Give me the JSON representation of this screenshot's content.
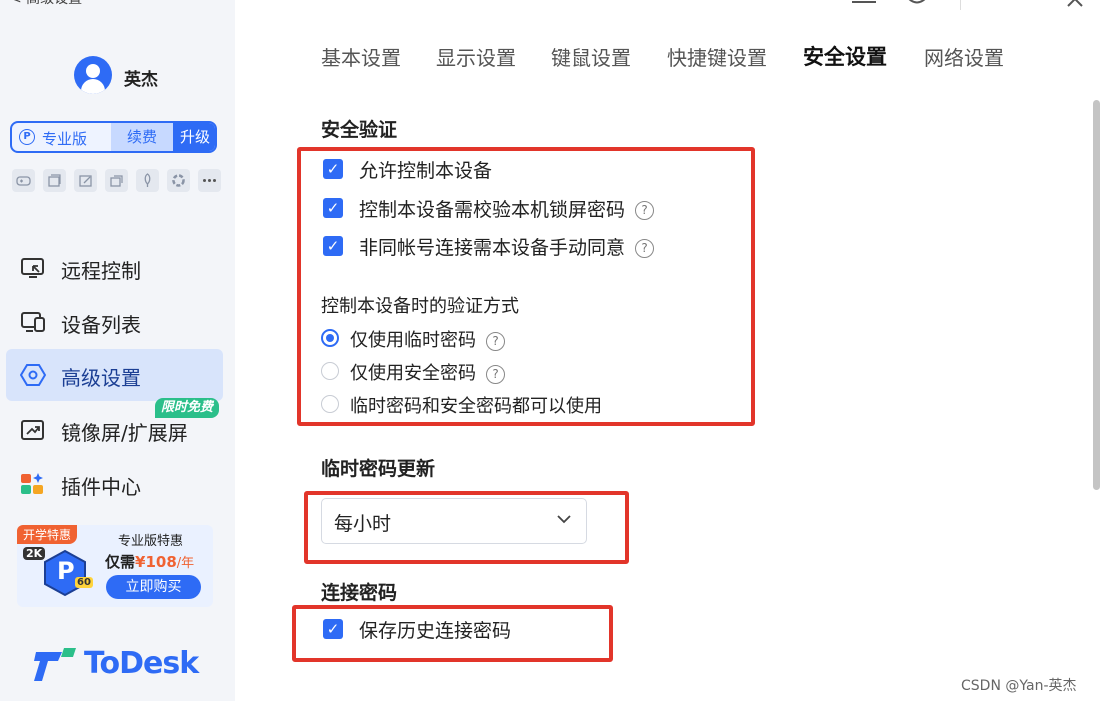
{
  "sidebar": {
    "top_cut_text": "< 高级设置",
    "username": "英杰",
    "plan": {
      "badge": "P",
      "name": "专业版",
      "renew": "续费",
      "upgrade": "升级"
    },
    "tools": [
      "gamepad-icon",
      "window-icon",
      "edit-icon",
      "copy-icon",
      "rocket-icon",
      "ring-icon",
      "more-icon"
    ],
    "nav": [
      {
        "label": "远程控制",
        "icon": "remote-control-icon"
      },
      {
        "label": "设备列表",
        "icon": "device-list-icon"
      },
      {
        "label": "高级设置",
        "icon": "advanced-settings-icon",
        "active": true
      },
      {
        "label": "镜像屏/扩展屏",
        "icon": "mirror-screen-icon",
        "badge": "限时免费"
      },
      {
        "label": "插件中心",
        "icon": "plugin-center-icon"
      }
    ],
    "ad": {
      "tag": "开学特惠",
      "title": "专业版特惠",
      "price_prefix": "仅需",
      "price": "¥108",
      "price_suffix": "/年",
      "buy": "立即购买",
      "badge_2k": "2K",
      "badge_60": "60",
      "mascot_letter": "P"
    },
    "logo_text": "ToDesk"
  },
  "window_controls": {
    "menu": "—",
    "bell": "🔔",
    "close": "✕"
  },
  "tabs": [
    "基本设置",
    "显示设置",
    "键鼠设置",
    "快捷键设置",
    "安全设置",
    "网络设置"
  ],
  "active_tab_index": 4,
  "security": {
    "title": "安全验证",
    "checks": [
      {
        "label": "允许控制本设备",
        "checked": true,
        "help": false
      },
      {
        "label": "控制本设备需校验本机锁屏密码",
        "checked": true,
        "help": true
      },
      {
        "label": "非同帐号连接需本设备手动同意",
        "checked": true,
        "help": true
      }
    ],
    "verify_title": "控制本设备时的验证方式",
    "verify_options": [
      {
        "label": "仅使用临时密码",
        "selected": true,
        "help": true
      },
      {
        "label": "仅使用安全密码",
        "selected": false,
        "help": true
      },
      {
        "label": "临时密码和安全密码都可以使用",
        "selected": false,
        "help": false
      }
    ]
  },
  "temp_password": {
    "title": "临时密码更新",
    "value": "每小时"
  },
  "connection_password": {
    "title": "连接密码",
    "save_history": "保存历史连接密码",
    "checked": true
  },
  "help_glyph": "?",
  "check_glyph": "✓",
  "watermark": "CSDN @Yan-英杰",
  "colors": {
    "accent": "#2e6bf5",
    "highlight_box": "#e2352a",
    "promo_green": "#2bbf8a",
    "promo_orange": "#f06232"
  }
}
